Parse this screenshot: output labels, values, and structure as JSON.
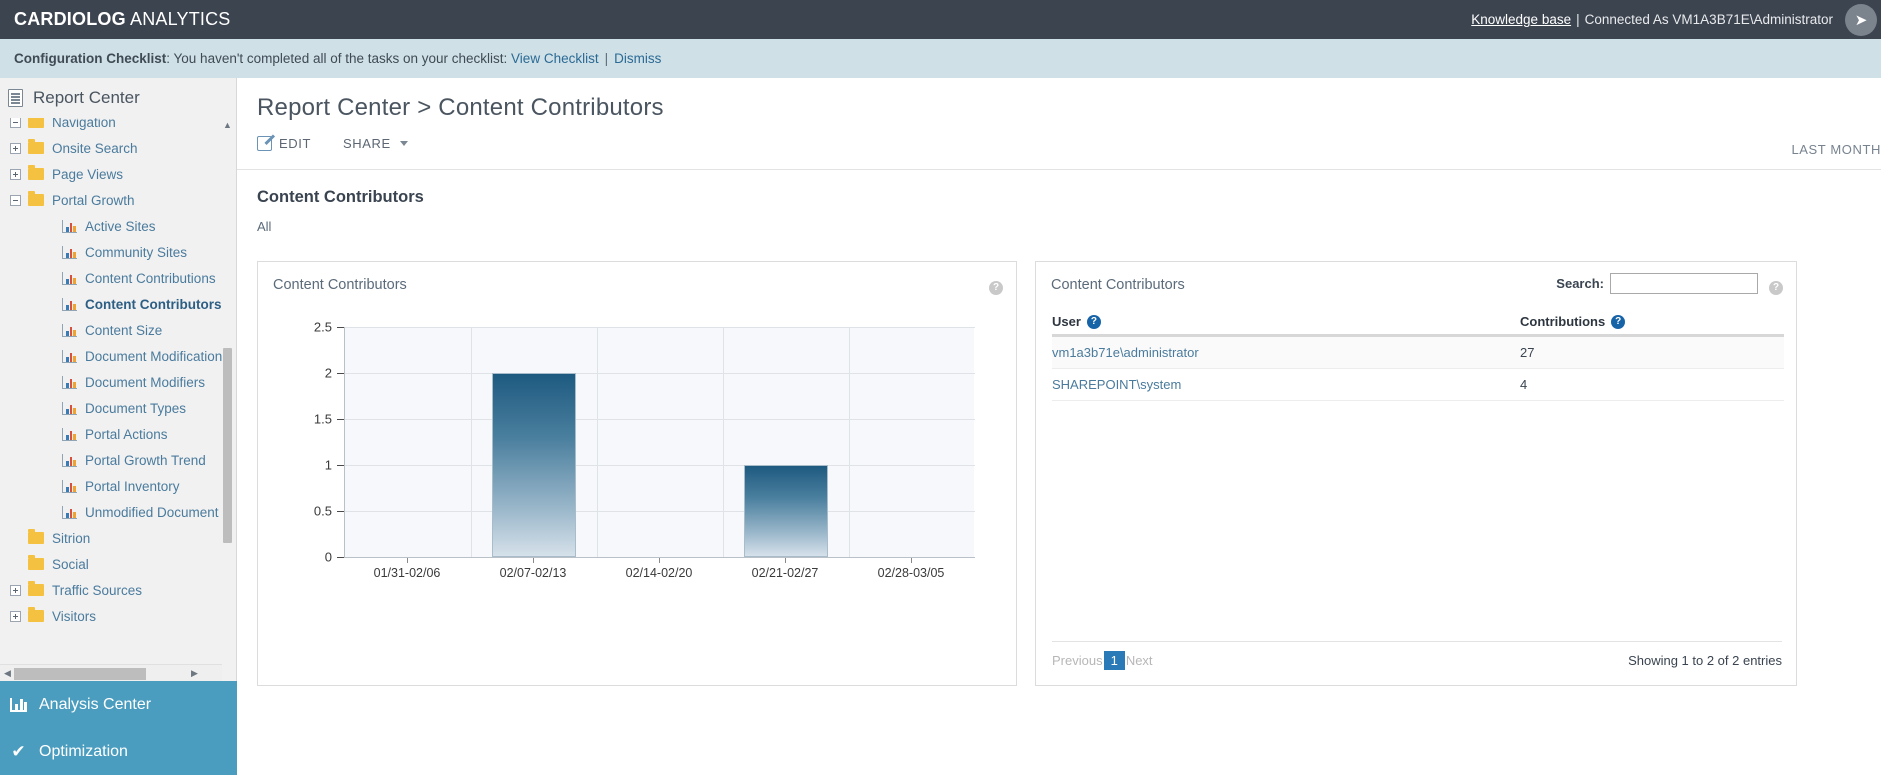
{
  "topbar": {
    "brand_bold": "CARDIOLOG",
    "brand_light": " ANALYTICS",
    "knowledge_base": "Knowledge base",
    "separator": "|",
    "connected_as": "Connected As VM1A3B71E\\Administrator",
    "user_icon": "navigation-arrow-icon"
  },
  "notice": {
    "label": "Configuration Checklist",
    "text": ": You haven't completed all of the tasks on your checklist: ",
    "view_link": "View Checklist",
    "divider": "|",
    "dismiss_link": "Dismiss"
  },
  "sidebar": {
    "header": "Report Center",
    "tree": [
      {
        "label": "Navigation",
        "type": "folder",
        "expander": "minus",
        "level": 1
      },
      {
        "label": "Onsite Search",
        "type": "folder",
        "expander": "plus",
        "level": 1
      },
      {
        "label": "Page Views",
        "type": "folder",
        "expander": "plus",
        "level": 1
      },
      {
        "label": "Portal Growth",
        "type": "folder",
        "expander": "minus",
        "level": 1
      },
      {
        "label": "Active Sites",
        "type": "report",
        "expander": "none",
        "level": 2
      },
      {
        "label": "Community Sites",
        "type": "report",
        "expander": "none",
        "level": 2
      },
      {
        "label": "Content Contributions",
        "type": "report",
        "expander": "none",
        "level": 2
      },
      {
        "label": "Content Contributors",
        "type": "report",
        "expander": "none",
        "level": 2,
        "selected": true
      },
      {
        "label": "Content Size",
        "type": "report",
        "expander": "none",
        "level": 2
      },
      {
        "label": "Document Modification",
        "type": "report",
        "expander": "none",
        "level": 2
      },
      {
        "label": "Document Modifiers",
        "type": "report",
        "expander": "none",
        "level": 2
      },
      {
        "label": "Document Types",
        "type": "report",
        "expander": "none",
        "level": 2
      },
      {
        "label": "Portal Actions",
        "type": "report",
        "expander": "none",
        "level": 2
      },
      {
        "label": "Portal Growth Trend",
        "type": "report",
        "expander": "none",
        "level": 2
      },
      {
        "label": "Portal Inventory",
        "type": "report",
        "expander": "none",
        "level": 2
      },
      {
        "label": "Unmodified Document",
        "type": "report",
        "expander": "none",
        "level": 2
      },
      {
        "label": "Sitrion",
        "type": "folder",
        "expander": "none",
        "level": 1
      },
      {
        "label": "Social",
        "type": "folder",
        "expander": "none",
        "level": 1
      },
      {
        "label": "Traffic Sources",
        "type": "folder",
        "expander": "plus",
        "level": 1
      },
      {
        "label": "Visitors",
        "type": "folder",
        "expander": "plus",
        "level": 1
      }
    ],
    "bottom": [
      {
        "label": "Analysis Center",
        "icon": "bar-chart-icon"
      },
      {
        "label": "Optimization",
        "icon": "check-icon"
      }
    ]
  },
  "main": {
    "page_title": "Report Center > Content Contributors",
    "toolbar": {
      "edit": "EDIT",
      "share": "SHARE",
      "date_range": "LAST MONTH"
    },
    "report_title": "Content Contributors",
    "report_scope": "All"
  },
  "chart_widget": {
    "title": "Content Contributors",
    "help_icon": "help-icon"
  },
  "table_widget": {
    "title": "Content Contributors",
    "search_label": "Search:",
    "search_value": "",
    "search_placeholder": "",
    "help_icon": "help-icon",
    "columns": [
      "User",
      "Contributions"
    ],
    "rows": [
      {
        "user": "vm1a3b71e\\administrator",
        "contributions": "27"
      },
      {
        "user": "SHAREPOINT\\system",
        "contributions": "4"
      }
    ],
    "pagination": {
      "previous": "Previous",
      "current_page": "1",
      "next": "Next"
    },
    "showing": "Showing 1 to 2 of 2 entries"
  },
  "chart_data": {
    "type": "bar",
    "title": "Content Contributors",
    "categories": [
      "01/31-02/06",
      "02/07-02/13",
      "02/14-02/20",
      "02/21-02/27",
      "02/28-03/05"
    ],
    "values": [
      0,
      2,
      0,
      1,
      0
    ],
    "xlabel": "",
    "ylabel": "",
    "ylim": [
      0,
      2.5
    ],
    "yticks": [
      "0",
      "0.5",
      "1",
      "1.5",
      "2",
      "2.5"
    ],
    "grid": true,
    "legend": "none",
    "bar_color_top": "#1e5a80",
    "bar_color_bottom": "#d6e1ea"
  }
}
